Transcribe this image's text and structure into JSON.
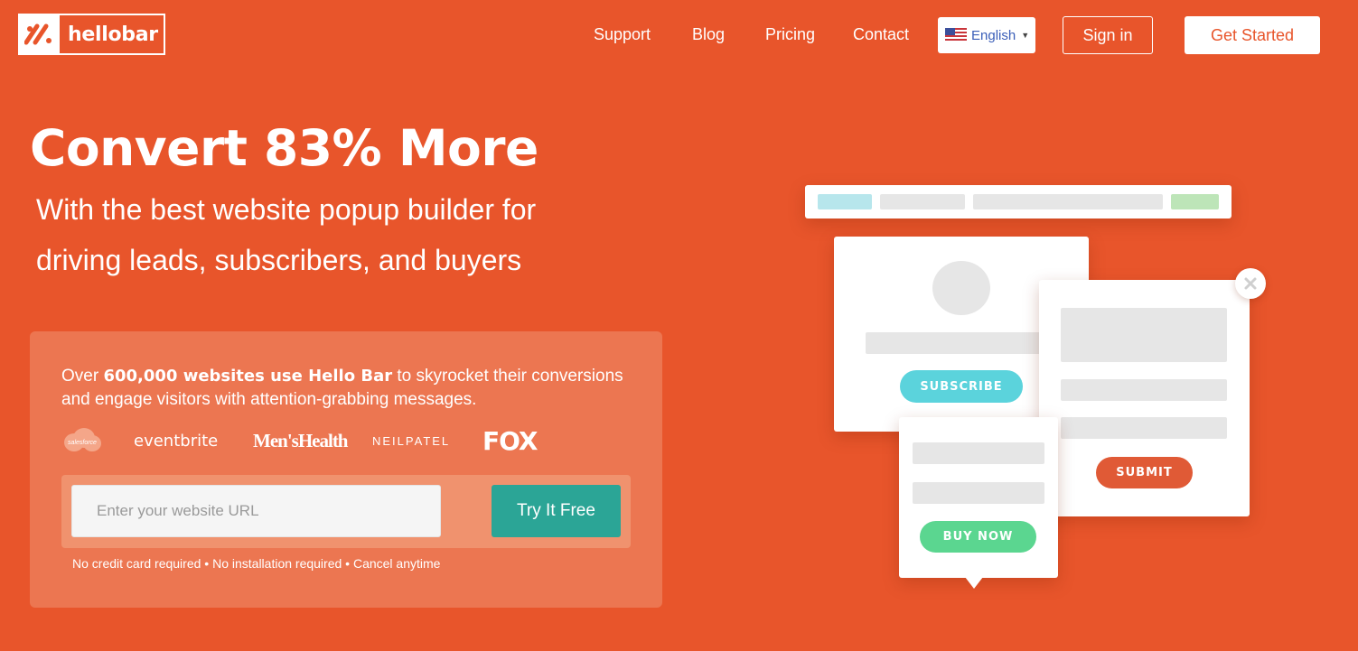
{
  "header": {
    "logo_text": "hellobar",
    "nav": [
      "Support",
      "Blog",
      "Pricing",
      "Contact"
    ],
    "language": "English",
    "sign_in": "Sign in",
    "get_started": "Get Started"
  },
  "hero": {
    "headline": "Convert 83% More",
    "subline_1": "With the best website popup builder for",
    "subline_2": "driving leads, subscribers, and buyers"
  },
  "card": {
    "text_prefix": "Over ",
    "text_bold": "600,000 websites use Hello Bar",
    "text_suffix": " to skyrocket their conversions and engage visitors with attention-grabbing messages.",
    "brands": [
      "salesforce",
      "eventbrite",
      "Men'sHealth",
      "NEILPATEL",
      "FOX"
    ],
    "url_placeholder": "Enter your website URL",
    "try_button": "Try It Free",
    "fineprint": "No credit card required • No installation required • Cancel anytime"
  },
  "illustration": {
    "subscribe_label": "SUBSCRIBE",
    "submit_label": "SUBMIT",
    "buy_now_label": "BUY NOW"
  },
  "colors": {
    "background": "#e8552b",
    "card": "#ec7651",
    "try_button": "#2ba596",
    "subscribe": "#5bd3dc",
    "submit": "#e05a36",
    "buy_now": "#5bd690"
  }
}
